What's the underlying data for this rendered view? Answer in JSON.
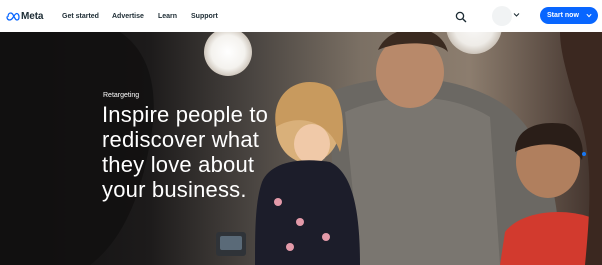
{
  "header": {
    "logo_text": "Meta",
    "nav": [
      "Get started",
      "Advertise",
      "Learn",
      "Support"
    ],
    "cta_label": "Start now"
  },
  "hero": {
    "eyebrow": "Retargeting",
    "headline": "Inspire people to\nrediscover what\nthey love about\nyour business."
  },
  "colors": {
    "brand_blue": "#0866ff",
    "text_dark": "#1c2b33",
    "hero_text": "#ffffff"
  },
  "icons": {
    "logo": "meta-infinity-icon",
    "search": "search-icon",
    "avatar_menu": "chevron-down-icon",
    "cta_menu": "chevron-down-icon"
  }
}
